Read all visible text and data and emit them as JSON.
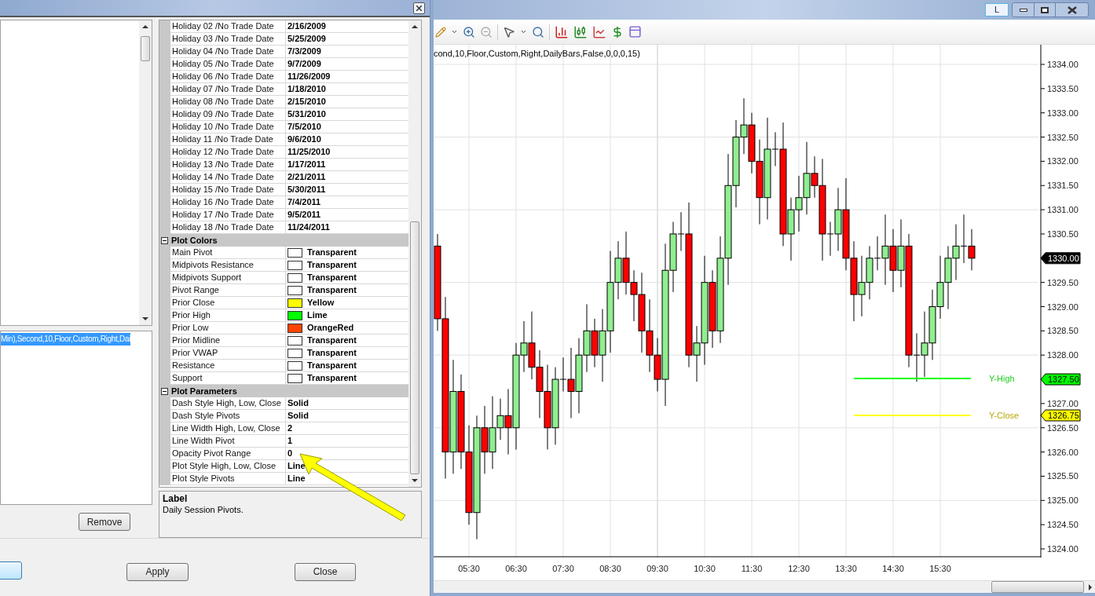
{
  "dialog": {
    "chart_items": [
      {
        "text": "Min),Second,10,Floor,Custom,Right,Dai",
        "selected": true
      }
    ],
    "remove_button": "Remove",
    "property_grid": {
      "sections": [
        {
          "rows": [
            {
              "name": "Holiday 02 /No Trade Date",
              "value": "2/16/2009"
            },
            {
              "name": "Holiday 03 /No Trade Date",
              "value": "5/25/2009"
            },
            {
              "name": "Holiday 04 /No Trade Date",
              "value": "7/3/2009"
            },
            {
              "name": "Holiday 05 /No Trade Date",
              "value": "9/7/2009"
            },
            {
              "name": "Holiday 06 /No Trade Date",
              "value": "11/26/2009"
            },
            {
              "name": "Holiday 07 /No Trade Date",
              "value": "1/18/2010"
            },
            {
              "name": "Holiday 08 /No Trade Date",
              "value": "2/15/2010"
            },
            {
              "name": "Holiday 09 /No Trade Date",
              "value": "5/31/2010"
            },
            {
              "name": "Holiday 10 /No Trade Date",
              "value": "7/5/2010"
            },
            {
              "name": "Holiday 11 /No Trade Date",
              "value": "9/6/2010"
            },
            {
              "name": "Holiday 12 /No Trade Date",
              "value": "11/25/2010"
            },
            {
              "name": "Holiday 13 /No Trade Date",
              "value": "1/17/2011"
            },
            {
              "name": "Holiday 14 /No Trade Date",
              "value": "2/21/2011"
            },
            {
              "name": "Holiday 15 /No Trade Date",
              "value": "5/30/2011"
            },
            {
              "name": "Holiday 16 /No Trade Date",
              "value": "7/4/2011"
            },
            {
              "name": "Holiday 17 /No Trade Date",
              "value": "9/5/2011"
            },
            {
              "name": "Holiday 18 /No Trade Date",
              "value": "11/24/2011"
            }
          ]
        },
        {
          "title": "Plot Colors",
          "expanded": true,
          "rows": [
            {
              "name": "Main Pivot",
              "value": "Transparent",
              "color": "#ffffff"
            },
            {
              "name": "Midpivots Resistance",
              "value": "Transparent",
              "color": "#ffffff"
            },
            {
              "name": "Midpivots Support",
              "value": "Transparent",
              "color": "#ffffff"
            },
            {
              "name": "Pivot Range",
              "value": "Transparent",
              "color": "#ffffff"
            },
            {
              "name": "Prior Close",
              "value": "Yellow",
              "color": "#ffff00"
            },
            {
              "name": "Prior High",
              "value": "Lime",
              "color": "#00ff00"
            },
            {
              "name": "Prior Low",
              "value": "OrangeRed",
              "color": "#ff4500"
            },
            {
              "name": "Prior Midline",
              "value": "Transparent",
              "color": "#ffffff"
            },
            {
              "name": "Prior VWAP",
              "value": "Transparent",
              "color": "#ffffff"
            },
            {
              "name": "Resistance",
              "value": "Transparent",
              "color": "#ffffff"
            },
            {
              "name": "Support",
              "value": "Transparent",
              "color": "#ffffff"
            }
          ]
        },
        {
          "title": "Plot Parameters",
          "expanded": true,
          "rows": [
            {
              "name": "Dash Style High, Low, Close",
              "value": "Solid"
            },
            {
              "name": "Dash Style Pivots",
              "value": "Solid"
            },
            {
              "name": "Line Width High, Low, Close",
              "value": "2"
            },
            {
              "name": "Line Width Pivot",
              "value": "1"
            },
            {
              "name": "Opacity Pivot Range",
              "value": "0"
            },
            {
              "name": "Plot Style High, Low, Close",
              "value": "Line"
            },
            {
              "name": "Plot Style Pivots",
              "value": "Line"
            }
          ]
        }
      ]
    },
    "description": {
      "title": "Label",
      "text": "Daily Session Pivots."
    },
    "apply_button": "Apply",
    "close_button": "Close"
  },
  "chart": {
    "mode_button": "L",
    "indicator_text": "cond,10,Floor,Custom,Right,DailyBars,False,0,0,0,15)",
    "price_axis": [
      {
        "kind": "tick",
        "text": "1334.00"
      },
      {
        "kind": "tick",
        "text": "1333.50"
      },
      {
        "kind": "tick",
        "text": "1333.00"
      },
      {
        "kind": "tick",
        "text": "1332.50"
      },
      {
        "kind": "tick",
        "text": "1332.00"
      },
      {
        "kind": "tick",
        "text": "1331.50"
      },
      {
        "kind": "tick",
        "text": "1331.00"
      },
      {
        "kind": "tick",
        "text": "1330.50"
      },
      {
        "kind": "tag",
        "text": "1330.00",
        "color": "#000000"
      },
      {
        "kind": "tick",
        "text": "1329.50"
      },
      {
        "kind": "tick",
        "text": "1329.00"
      },
      {
        "kind": "tick",
        "text": "1328.50"
      },
      {
        "kind": "tick",
        "text": "1328.00"
      },
      {
        "kind": "tag",
        "text": "1327.50",
        "color": "#00ff00"
      },
      {
        "kind": "tick",
        "text": "1327.00"
      },
      {
        "kind": "tick",
        "text": "1326.50"
      },
      {
        "kind": "tick",
        "text": "1326.00"
      },
      {
        "kind": "tick",
        "text": "1325.50"
      },
      {
        "kind": "tick",
        "text": "1325.00"
      },
      {
        "kind": "tick",
        "text": "1324.50"
      },
      {
        "kind": "tick",
        "text": "1324.00"
      }
    ],
    "plot_lines": [
      {
        "label": "Y-High",
        "color": "#00ff00"
      },
      {
        "label": "Y-Close",
        "color": "#ffff00",
        "tag": "1326.75"
      }
    ],
    "time_axis": [
      "05:30",
      "06:30",
      "07:30",
      "08:30",
      "09:30",
      "10:30",
      "11:30",
      "12:30",
      "13:30",
      "14:30",
      "15:30"
    ]
  }
}
